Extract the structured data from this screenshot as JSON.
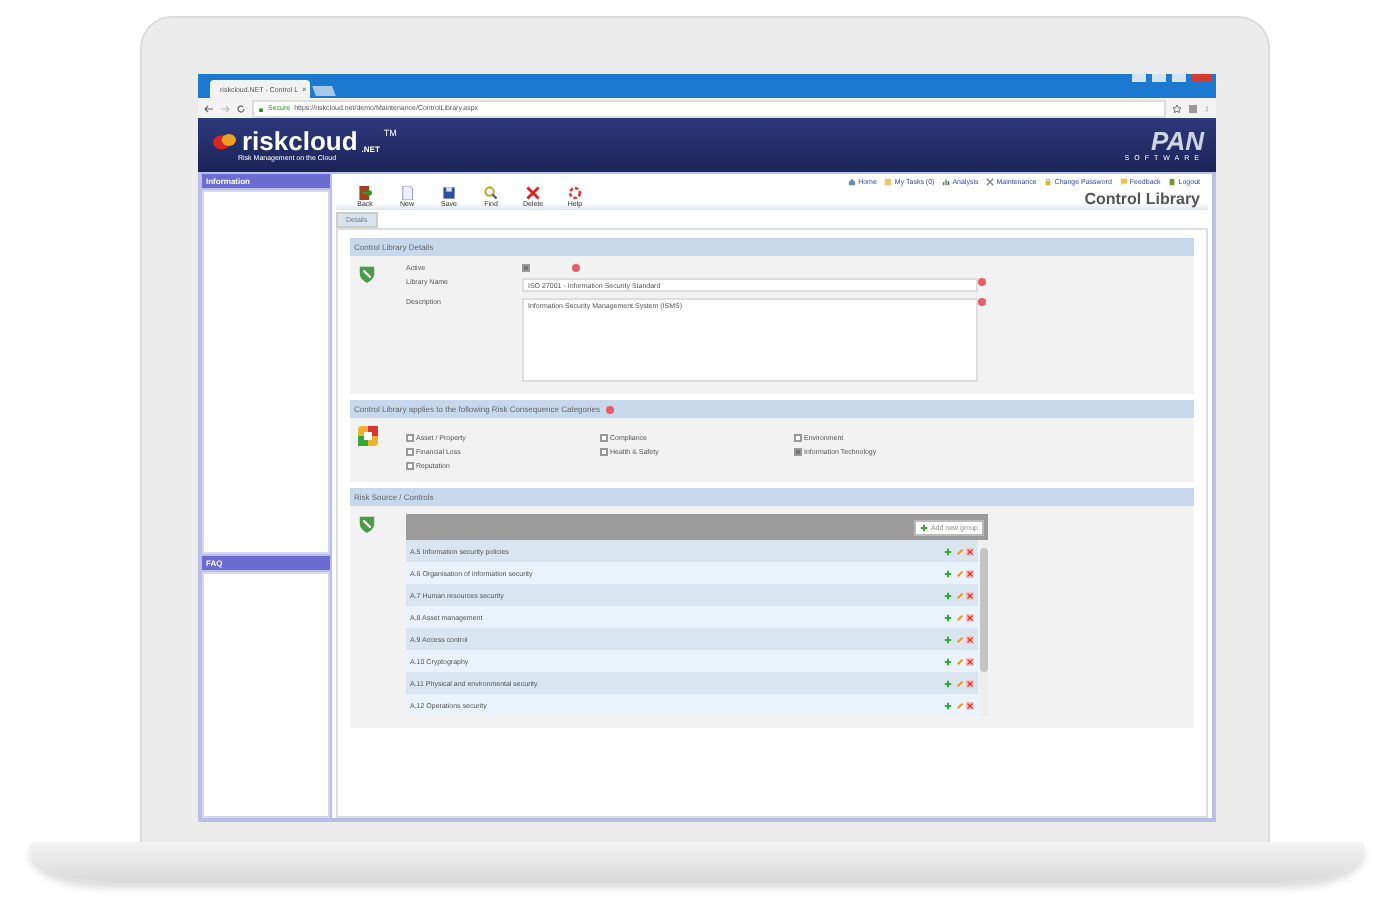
{
  "browser": {
    "tab_title": "riskcloud.NET - Control L",
    "close": "×",
    "secure": "Secure",
    "url": "https://riskcloud.net/demo/Maintenance/ControlLibrary.aspx"
  },
  "header": {
    "logo": "riskcloud",
    "logo_suffix": ".NET",
    "logo_tm": "TM",
    "tagline": "Risk Management on the Cloud",
    "vendor_logo": "PAN",
    "vendor_sub": "SOFTWARE"
  },
  "sidebar": [
    {
      "title": "Information"
    },
    {
      "title": "FAQ"
    }
  ],
  "nav_links": [
    {
      "label": "Home",
      "kind": "home"
    },
    {
      "label": "My Tasks (0)",
      "kind": "tasks"
    },
    {
      "label": "Analysis",
      "kind": "analysis"
    },
    {
      "label": "Maintenance",
      "kind": "maintenance"
    },
    {
      "label": "Change Password",
      "kind": "lock"
    },
    {
      "label": "Feedback",
      "kind": "feedback"
    },
    {
      "label": "Logout",
      "kind": "logout"
    }
  ],
  "toolbar": [
    {
      "label": "Back",
      "kind": "back"
    },
    {
      "label": "New",
      "kind": "new"
    },
    {
      "label": "Save",
      "kind": "save"
    },
    {
      "label": "Find",
      "kind": "find"
    },
    {
      "label": "Delete",
      "kind": "delete"
    },
    {
      "label": "Help",
      "kind": "help"
    }
  ],
  "page_title": "Control Library",
  "tabs": [
    {
      "label": "Details",
      "selected": true
    }
  ],
  "details": {
    "title": "Control Library Details",
    "active": {
      "label": "Active",
      "checked": true
    },
    "library_name": {
      "label": "Library Name",
      "value": "ISO 27001 - Information Security Standard"
    },
    "description": {
      "label": "Description",
      "value": "Information Security Management System (ISMS)"
    }
  },
  "categories": {
    "title": "Control Library applies to the following Risk Consequence Categories",
    "items": [
      {
        "label": "Asset / Property",
        "checked": false
      },
      {
        "label": "Compliance",
        "checked": false
      },
      {
        "label": "Environment",
        "checked": false
      },
      {
        "label": "Financial Loss",
        "checked": false
      },
      {
        "label": "Health & Safety",
        "checked": false
      },
      {
        "label": "Information Technology",
        "checked": true
      },
      {
        "label": "Reputation",
        "checked": false
      }
    ]
  },
  "controls": {
    "title": "Risk Source / Controls",
    "add_button": "Add new group",
    "rows": [
      {
        "label": "A.5 Information security policies"
      },
      {
        "label": "A.6 Organisation of information security"
      },
      {
        "label": "A.7 Human resources security"
      },
      {
        "label": "A.8 Asset management"
      },
      {
        "label": "A.9 Access control"
      },
      {
        "label": "A.10 Cryptography"
      },
      {
        "label": "A.11 Physical and environmental security"
      },
      {
        "label": "A.12 Operations security"
      }
    ]
  }
}
